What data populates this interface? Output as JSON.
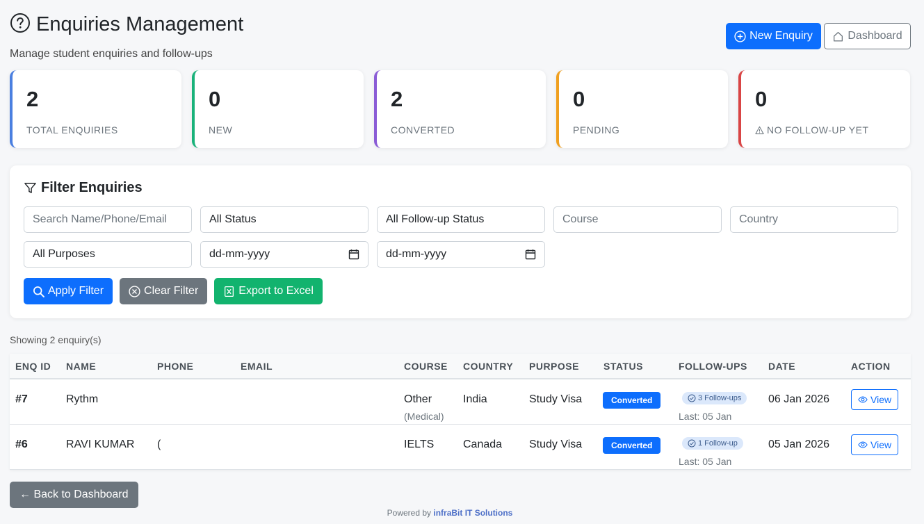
{
  "header": {
    "title": "Enquiries Management",
    "subtitle": "Manage student enquiries and follow-ups"
  },
  "top_actions": {
    "new_enquiry": "New Enquiry",
    "dashboard": "Dashboard"
  },
  "stats": [
    {
      "value": "2",
      "label": "TOTAL ENQUIRIES",
      "color": "#4a7fe0"
    },
    {
      "value": "0",
      "label": "NEW",
      "color": "#19b27a"
    },
    {
      "value": "2",
      "label": "CONVERTED",
      "color": "#8a5cd6"
    },
    {
      "value": "0",
      "label": "PENDING",
      "color": "#f0a020"
    },
    {
      "value": "0",
      "label": "NO FOLLOW-UP YET",
      "color": "#d94545"
    }
  ],
  "filter": {
    "title": "Filter Enquiries",
    "search_placeholder": "Search Name/Phone/Email",
    "status": "All Status",
    "followup_status": "All Follow-up Status",
    "course_placeholder": "Course",
    "country_placeholder": "Country",
    "purpose": "All Purposes",
    "date_from": "dd-mm-yyyy",
    "date_to": "dd-mm-yyyy",
    "apply": "Apply Filter",
    "clear": "Clear Filter",
    "export": "Export to Excel"
  },
  "showing": "Showing 2 enquiry(s)",
  "table": {
    "headers": [
      "ENQ ID",
      "NAME",
      "PHONE",
      "EMAIL",
      "COURSE",
      "COUNTRY",
      "PURPOSE",
      "STATUS",
      "FOLLOW-UPS",
      "DATE",
      "ACTION"
    ],
    "rows": [
      {
        "id": "#7",
        "name": "Rythm",
        "phone": "",
        "email": "",
        "course": "Other",
        "course_sub": "(Medical)",
        "country": "India",
        "purpose": "Study Visa",
        "status": "Converted",
        "followups": "3 Follow-ups",
        "last": "Last: 05 Jan",
        "date": "06 Jan 2026",
        "action": "View"
      },
      {
        "id": "#6",
        "name": "RAVI KUMAR",
        "phone": "(",
        "email": "",
        "course": "IELTS",
        "course_sub": "",
        "country": "Canada",
        "purpose": "Study Visa",
        "status": "Converted",
        "followups": "1 Follow-up",
        "last": "Last: 05 Jan",
        "date": "05 Jan 2026",
        "action": "View"
      }
    ]
  },
  "back_button": "← Back to Dashboard",
  "footer": {
    "prefix": "Powered by",
    "brand": "infraBit IT Solutions"
  }
}
